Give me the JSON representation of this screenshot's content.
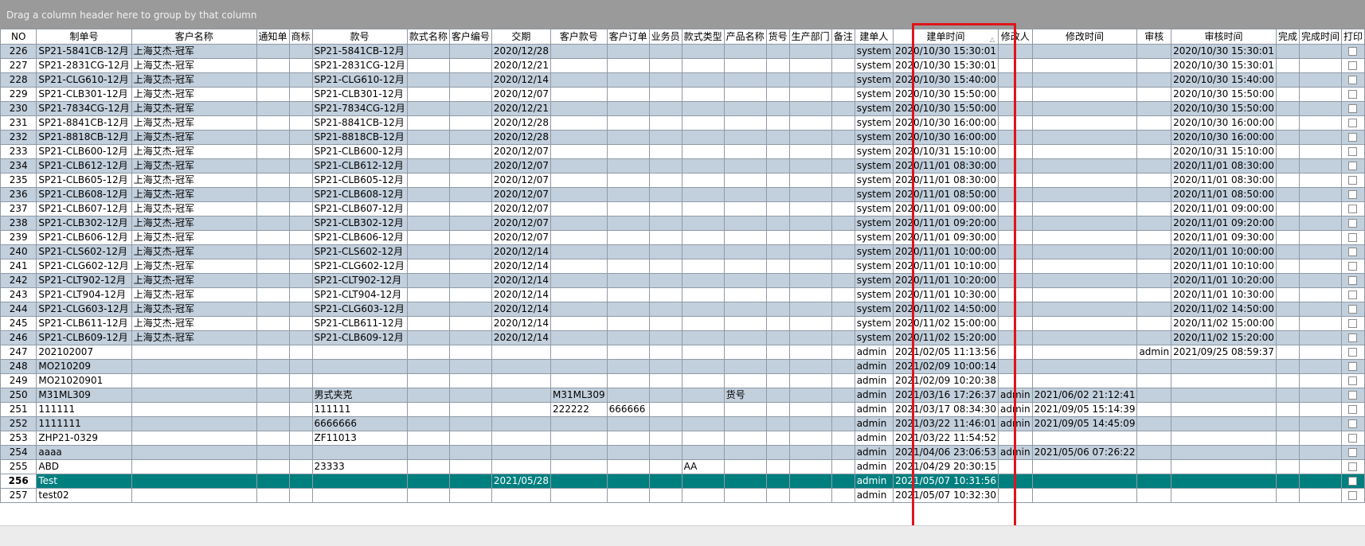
{
  "group_bar_text": "Drag a column header here to group by that column",
  "accent_color": "#e0141c",
  "selected_row_color": "#007f7f",
  "alt_row_color": "#c2cfdc",
  "columns": [
    {
      "key": "no",
      "label": "NO"
    },
    {
      "key": "zhidan",
      "label": "制单号"
    },
    {
      "key": "kehu",
      "label": "客户名称"
    },
    {
      "key": "tongzhi",
      "label": "通知单"
    },
    {
      "key": "shangbiao",
      "label": "商标"
    },
    {
      "key": "kuanhao",
      "label": "款号"
    },
    {
      "key": "kuanshimingcheng",
      "label": "款式名称"
    },
    {
      "key": "kehubianhao",
      "label": "客户编号"
    },
    {
      "key": "jiaoqi",
      "label": "交期"
    },
    {
      "key": "kehukuanhao",
      "label": "客户款号"
    },
    {
      "key": "kehudingdan",
      "label": "客户订单"
    },
    {
      "key": "yewuyuan",
      "label": "业务员"
    },
    {
      "key": "kuanshileixing",
      "label": "款式类型"
    },
    {
      "key": "chanpinmingcheng",
      "label": "产品名称"
    },
    {
      "key": "huohao",
      "label": "货号"
    },
    {
      "key": "shengchanbumen",
      "label": "生产部门"
    },
    {
      "key": "beizhu",
      "label": "备注"
    },
    {
      "key": "jiandanren",
      "label": "建单人"
    },
    {
      "key": "jiandanshijian",
      "label": "建单时间",
      "sort": "ascending"
    },
    {
      "key": "xiugairen",
      "label": "修改人"
    },
    {
      "key": "xiugaishijian",
      "label": "修改时间"
    },
    {
      "key": "shenhe",
      "label": "审核"
    },
    {
      "key": "shenheshijian",
      "label": "审核时间"
    },
    {
      "key": "wancheng",
      "label": "完成"
    },
    {
      "key": "wanchengshijian",
      "label": "完成时间"
    },
    {
      "key": "dayin",
      "label": "打印"
    }
  ],
  "rows": [
    {
      "no": "226",
      "zhidan": "SP21-5841CB-12月",
      "kehu": "上海艾杰-冠军",
      "kuanhao": "SP21-5841CB-12月",
      "jiaoqi": "2020/12/28",
      "jiandanren": "system",
      "jiandanshijian": "2020/10/30 15:30:01",
      "shenheshijian": "2020/10/30 15:30:01"
    },
    {
      "no": "227",
      "zhidan": "SP21-2831CG-12月",
      "kehu": "上海艾杰-冠军",
      "kuanhao": "SP21-2831CG-12月",
      "jiaoqi": "2020/12/21",
      "jiandanren": "system",
      "jiandanshijian": "2020/10/30 15:30:01",
      "shenheshijian": "2020/10/30 15:30:01"
    },
    {
      "no": "228",
      "zhidan": "SP21-CLG610-12月",
      "kehu": "上海艾杰-冠军",
      "kuanhao": "SP21-CLG610-12月",
      "jiaoqi": "2020/12/14",
      "jiandanren": "system",
      "jiandanshijian": "2020/10/30 15:40:00",
      "shenheshijian": "2020/10/30 15:40:00"
    },
    {
      "no": "229",
      "zhidan": "SP21-CLB301-12月",
      "kehu": "上海艾杰-冠军",
      "kuanhao": "SP21-CLB301-12月",
      "jiaoqi": "2020/12/07",
      "jiandanren": "system",
      "jiandanshijian": "2020/10/30 15:50:00",
      "shenheshijian": "2020/10/30 15:50:00"
    },
    {
      "no": "230",
      "zhidan": "SP21-7834CG-12月",
      "kehu": "上海艾杰-冠军",
      "kuanhao": "SP21-7834CG-12月",
      "jiaoqi": "2020/12/21",
      "jiandanren": "system",
      "jiandanshijian": "2020/10/30 15:50:00",
      "shenheshijian": "2020/10/30 15:50:00"
    },
    {
      "no": "231",
      "zhidan": "SP21-8841CB-12月",
      "kehu": "上海艾杰-冠军",
      "kuanhao": "SP21-8841CB-12月",
      "jiaoqi": "2020/12/28",
      "jiandanren": "system",
      "jiandanshijian": "2020/10/30 16:00:00",
      "shenheshijian": "2020/10/30 16:00:00"
    },
    {
      "no": "232",
      "zhidan": "SP21-8818CB-12月",
      "kehu": "上海艾杰-冠军",
      "kuanhao": "SP21-8818CB-12月",
      "jiaoqi": "2020/12/28",
      "jiandanren": "system",
      "jiandanshijian": "2020/10/30 16:00:00",
      "shenheshijian": "2020/10/30 16:00:00"
    },
    {
      "no": "233",
      "zhidan": "SP21-CLB600-12月",
      "kehu": "上海艾杰-冠军",
      "kuanhao": "SP21-CLB600-12月",
      "jiaoqi": "2020/12/07",
      "jiandanren": "system",
      "jiandanshijian": "2020/10/31 15:10:00",
      "shenheshijian": "2020/10/31 15:10:00"
    },
    {
      "no": "234",
      "zhidan": "SP21-CLB612-12月",
      "kehu": "上海艾杰-冠军",
      "kuanhao": "SP21-CLB612-12月",
      "jiaoqi": "2020/12/07",
      "jiandanren": "system",
      "jiandanshijian": "2020/11/01 08:30:00",
      "shenheshijian": "2020/11/01 08:30:00"
    },
    {
      "no": "235",
      "zhidan": "SP21-CLB605-12月",
      "kehu": "上海艾杰-冠军",
      "kuanhao": "SP21-CLB605-12月",
      "jiaoqi": "2020/12/07",
      "jiandanren": "system",
      "jiandanshijian": "2020/11/01 08:30:00",
      "shenheshijian": "2020/11/01 08:30:00"
    },
    {
      "no": "236",
      "zhidan": "SP21-CLB608-12月",
      "kehu": "上海艾杰-冠军",
      "kuanhao": "SP21-CLB608-12月",
      "jiaoqi": "2020/12/07",
      "jiandanren": "system",
      "jiandanshijian": "2020/11/01 08:50:00",
      "shenheshijian": "2020/11/01 08:50:00"
    },
    {
      "no": "237",
      "zhidan": "SP21-CLB607-12月",
      "kehu": "上海艾杰-冠军",
      "kuanhao": "SP21-CLB607-12月",
      "jiaoqi": "2020/12/07",
      "jiandanren": "system",
      "jiandanshijian": "2020/11/01 09:00:00",
      "shenheshijian": "2020/11/01 09:00:00"
    },
    {
      "no": "238",
      "zhidan": "SP21-CLB302-12月",
      "kehu": "上海艾杰-冠军",
      "kuanhao": "SP21-CLB302-12月",
      "jiaoqi": "2020/12/07",
      "jiandanren": "system",
      "jiandanshijian": "2020/11/01 09:20:00",
      "shenheshijian": "2020/11/01 09:20:00"
    },
    {
      "no": "239",
      "zhidan": "SP21-CLB606-12月",
      "kehu": "上海艾杰-冠军",
      "kuanhao": "SP21-CLB606-12月",
      "jiaoqi": "2020/12/07",
      "jiandanren": "system",
      "jiandanshijian": "2020/11/01 09:30:00",
      "shenheshijian": "2020/11/01 09:30:00"
    },
    {
      "no": "240",
      "zhidan": "SP21-CLS602-12月",
      "kehu": "上海艾杰-冠军",
      "kuanhao": "SP21-CLS602-12月",
      "jiaoqi": "2020/12/14",
      "jiandanren": "system",
      "jiandanshijian": "2020/11/01 10:00:00",
      "shenheshijian": "2020/11/01 10:00:00"
    },
    {
      "no": "241",
      "zhidan": "SP21-CLG602-12月",
      "kehu": "上海艾杰-冠军",
      "kuanhao": "SP21-CLG602-12月",
      "jiaoqi": "2020/12/14",
      "jiandanren": "system",
      "jiandanshijian": "2020/11/01 10:10:00",
      "shenheshijian": "2020/11/01 10:10:00"
    },
    {
      "no": "242",
      "zhidan": "SP21-CLT902-12月",
      "kehu": "上海艾杰-冠军",
      "kuanhao": "SP21-CLT902-12月",
      "jiaoqi": "2020/12/14",
      "jiandanren": "system",
      "jiandanshijian": "2020/11/01 10:20:00",
      "shenheshijian": "2020/11/01 10:20:00"
    },
    {
      "no": "243",
      "zhidan": "SP21-CLT904-12月",
      "kehu": "上海艾杰-冠军",
      "kuanhao": "SP21-CLT904-12月",
      "jiaoqi": "2020/12/14",
      "jiandanren": "system",
      "jiandanshijian": "2020/11/01 10:30:00",
      "shenheshijian": "2020/11/01 10:30:00"
    },
    {
      "no": "244",
      "zhidan": "SP21-CLG603-12月",
      "kehu": "上海艾杰-冠军",
      "kuanhao": "SP21-CLG603-12月",
      "jiaoqi": "2020/12/14",
      "jiandanren": "system",
      "jiandanshijian": "2020/11/02 14:50:00",
      "shenheshijian": "2020/11/02 14:50:00"
    },
    {
      "no": "245",
      "zhidan": "SP21-CLB611-12月",
      "kehu": "上海艾杰-冠军",
      "kuanhao": "SP21-CLB611-12月",
      "jiaoqi": "2020/12/14",
      "jiandanren": "system",
      "jiandanshijian": "2020/11/02 15:00:00",
      "shenheshijian": "2020/11/02 15:00:00"
    },
    {
      "no": "246",
      "zhidan": "SP21-CLB609-12月",
      "kehu": "上海艾杰-冠军",
      "kuanhao": "SP21-CLB609-12月",
      "jiaoqi": "2020/12/14",
      "jiandanren": "system",
      "jiandanshijian": "2020/11/02 15:20:00",
      "shenheshijian": "2020/11/02 15:20:00"
    },
    {
      "no": "247",
      "zhidan": "202102007",
      "jiandanren": "admin",
      "jiandanshijian": "2021/02/05 11:13:56",
      "shenhe": "admin",
      "shenheshijian": "2021/09/25 08:59:37"
    },
    {
      "no": "248",
      "zhidan": "MO210209",
      "jiandanren": "admin",
      "jiandanshijian": "2021/02/09 10:00:14"
    },
    {
      "no": "249",
      "zhidan": "MO21020901",
      "jiandanren": "admin",
      "jiandanshijian": "2021/02/09 10:20:38"
    },
    {
      "no": "250",
      "zhidan": "M31ML309",
      "kuanhao": "男式夹克",
      "kehukuanhao": "M31ML309",
      "chanpinmingcheng": "货号",
      "jiandanren": "admin",
      "jiandanshijian": "2021/03/16 17:26:37",
      "xiugairen": "admin",
      "xiugaishijian": "2021/06/02 21:12:41"
    },
    {
      "no": "251",
      "zhidan": "111111",
      "kuanhao": "111111",
      "kehukuanhao": "222222",
      "kehudingdan": "666666",
      "jiandanren": "admin",
      "jiandanshijian": "2021/03/17 08:34:30",
      "xiugairen": "admin",
      "xiugaishijian": "2021/09/05 15:14:39"
    },
    {
      "no": "252",
      "zhidan": "1111111",
      "kuanhao": "6666666",
      "jiandanren": "admin",
      "jiandanshijian": "2021/03/22 11:46:01",
      "xiugairen": "admin",
      "xiugaishijian": "2021/09/05 14:45:09"
    },
    {
      "no": "253",
      "zhidan": "ZHP21-0329",
      "kuanhao": "ZF11013",
      "jiandanren": "admin",
      "jiandanshijian": "2021/03/22 11:54:52"
    },
    {
      "no": "254",
      "zhidan": "aaaa",
      "jiandanren": "admin",
      "jiandanshijian": "2021/04/06 23:06:53",
      "xiugairen": "admin",
      "xiugaishijian": "2021/05/06 07:26:22"
    },
    {
      "no": "255",
      "zhidan": "ABD",
      "kuanhao": "23333",
      "kuanshileixing": "AA",
      "jiandanren": "admin",
      "jiandanshijian": "2021/04/29 20:30:15"
    },
    {
      "no": "256",
      "zhidan": "Test",
      "jiaoqi": "2021/05/28",
      "jiandanren": "admin",
      "jiandanshijian": "2021/05/07 10:31:56",
      "selected": true
    },
    {
      "no": "257",
      "zhidan": "test02",
      "jiandanren": "admin",
      "jiandanshijian": "2021/05/07 10:32:30"
    }
  ]
}
